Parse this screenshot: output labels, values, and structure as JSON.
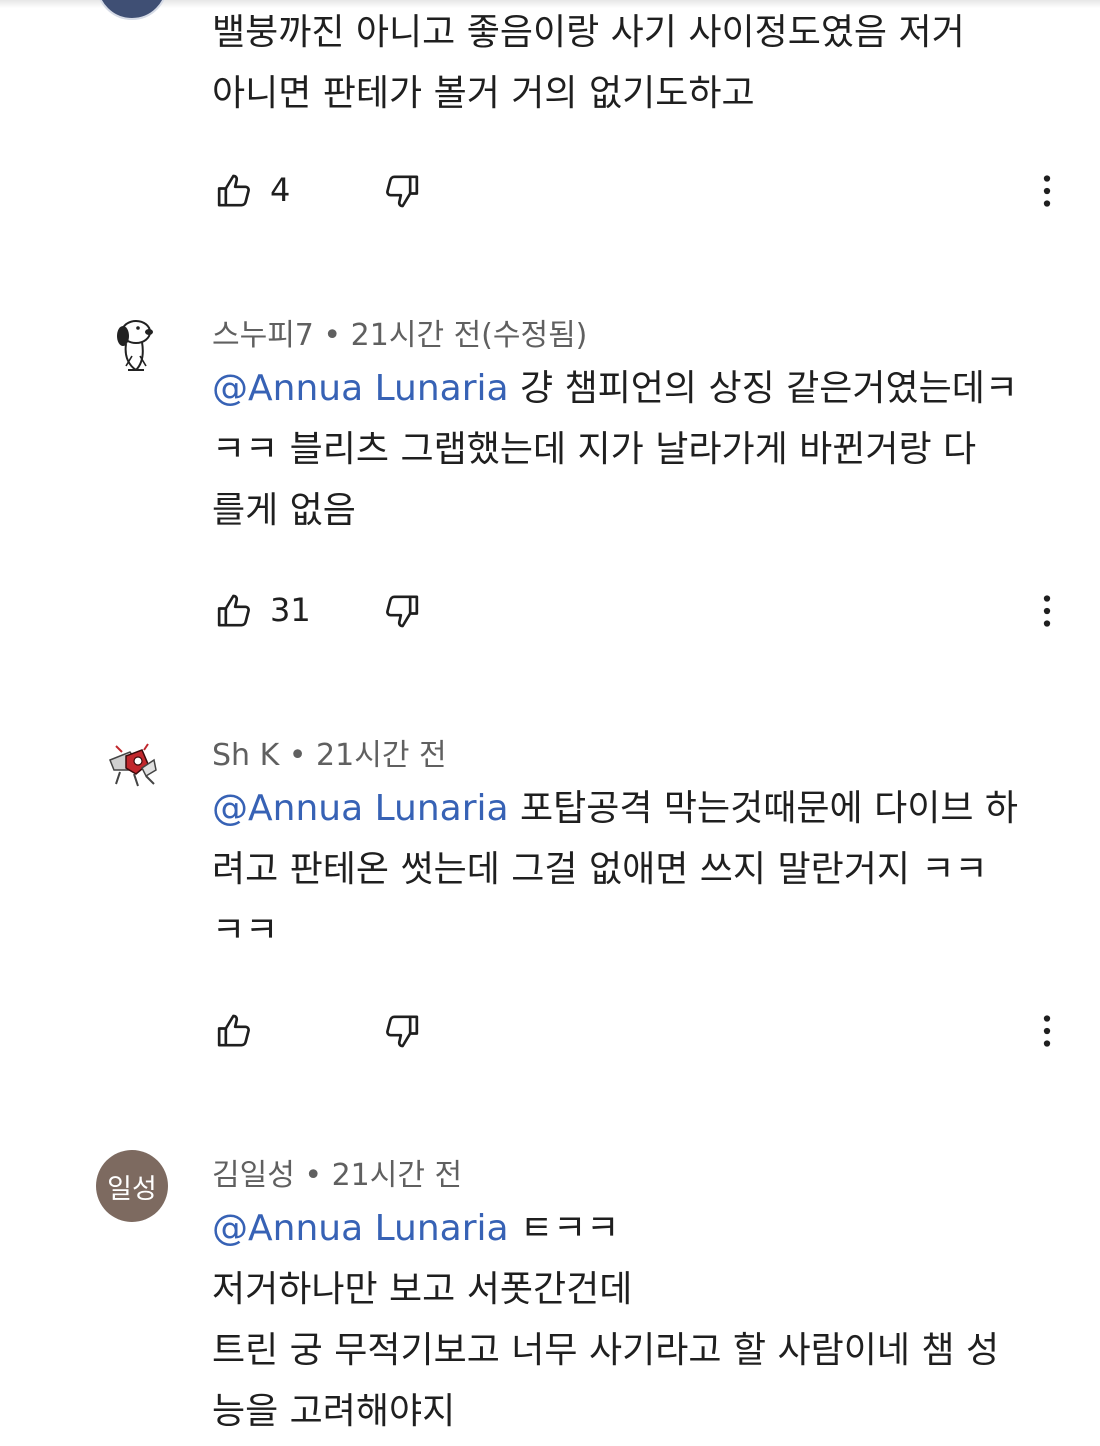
{
  "comments": [
    {
      "author": "",
      "timestamp": "",
      "mention": "",
      "lines": [
        "밸붕까진 아니고 좋음이랑 사기 사이정도였음 저거",
        "아니면 판테가 볼거 거의 없기도하고"
      ],
      "likes": "4",
      "avatar": "partial-avatar"
    },
    {
      "author": "스누피7",
      "timestamp": "21시간 전(수정됨)",
      "mention": "@Annua Lunaria",
      "lines": [
        " 걍 챔피언의 상징 같은거였는데ㅋ",
        "ㅋㅋ 블리츠 그랩했는데 지가 날라가게 바뀐거랑 다",
        "를게 없음"
      ],
      "likes": "31",
      "avatar": "snoopy-avatar"
    },
    {
      "author": "Sh K",
      "timestamp": "21시간 전",
      "mention": "@Annua Lunaria",
      "lines": [
        " 포탑공격 막는것때문에 다이브 하",
        "려고 판테온 썻는데 그걸 없애면 쓰지 말란거지 ㅋㅋ",
        "ㅋㅋ"
      ],
      "likes": "",
      "avatar": "robot-avatar"
    },
    {
      "author": "김일성",
      "timestamp": "21시간 전",
      "mention": "@Annua Lunaria",
      "lines": [
        " ㅌㅋㅋ",
        "저거하나만 보고 서폿간건데",
        "트린 궁 무적기보고 너무 사기라고 할 사람이네 챔 성",
        "능을 고려해야지"
      ],
      "likes": "",
      "avatar_text": "일성"
    }
  ],
  "separator": " • ",
  "colors": {
    "text": "#1f1f1f",
    "meta": "#606060",
    "mention": "#3762b5",
    "initials_avatar_bg": "#7d6a60"
  },
  "icons": [
    "thumb-up-icon",
    "thumb-down-icon",
    "more-vertical-icon"
  ]
}
